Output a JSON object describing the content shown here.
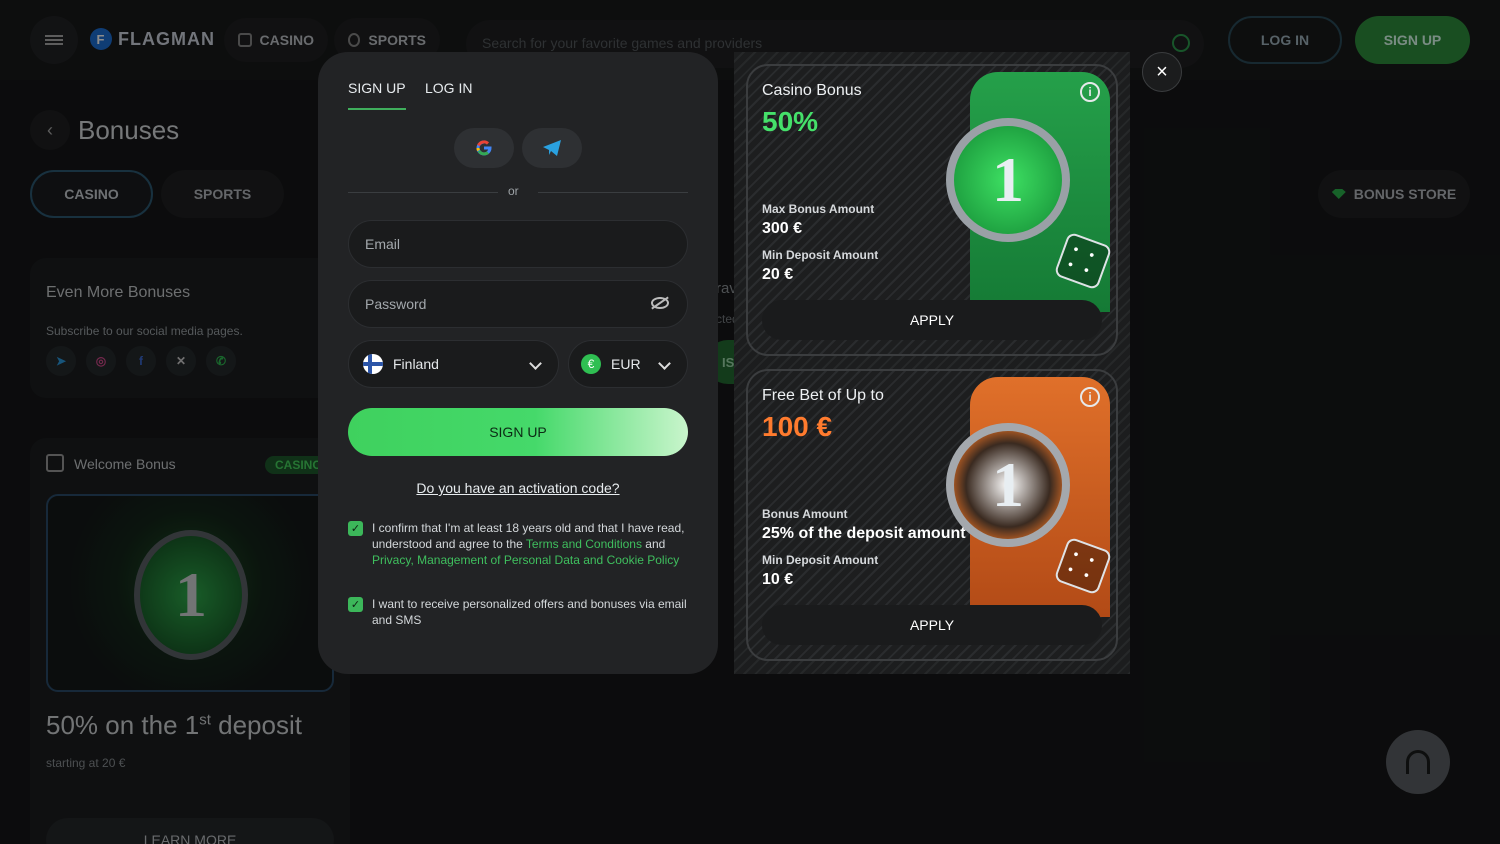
{
  "header": {
    "logo_letter": "F",
    "logo_text": "FLAGMAN",
    "nav_casino": "CASINO",
    "nav_sports": "SPORTS",
    "search_placeholder": "Search for your favorite games and providers",
    "login": "LOG IN",
    "signup": "SIGN UP"
  },
  "page": {
    "title": "Bonuses",
    "tab_casino": "CASINO",
    "tab_sports": "SPORTS",
    "bonus_store": "BONUS STORE",
    "more_title": "Even More Bonuses",
    "more_sub": "Subscribe to our social media pages.",
    "behind_title": "rave more?",
    "behind_sub": "cted poi",
    "behind_btn": "ISIT STORE",
    "welcome": {
      "title": "Welcome Bonus",
      "badge": "CASINO",
      "coin_number": "1",
      "pct_pre": "50% on the 1",
      "pct_sup": "st",
      "pct_post": " deposit",
      "starting": "starting at 20 €",
      "learn_more": "LEARN MORE"
    }
  },
  "modal": {
    "tab_signup": "SIGN UP",
    "tab_login": "LOG IN",
    "or": "or",
    "email_placeholder": "Email",
    "password_placeholder": "Password",
    "country": "Finland",
    "currency": "EUR",
    "currency_symbol": "€",
    "submit": "SIGN UP",
    "activation": "Do you have an activation code?",
    "consent1_pre": "I confirm that I'm at least 18 years old and that I have read, understood and agree to the ",
    "consent1_link1": "Terms and Conditions",
    "consent1_mid": " and ",
    "consent1_link2": "Privacy, Management of Personal Data and Cookie Policy",
    "consent2": "I want to receive personalized offers and bonuses via email and SMS",
    "consent1_checked": true,
    "consent2_checked": true
  },
  "bonuses": [
    {
      "title": "Casino Bonus",
      "value": "50%",
      "label1": "Max Bonus Amount",
      "value1": "300 €",
      "label2": "Min Deposit Amount",
      "value2": "20 €",
      "apply": "APPLY",
      "coin_number": "1",
      "accent": "#45e06a"
    },
    {
      "title": "Free Bet of Up to",
      "value": "100 €",
      "label1": "Bonus Amount",
      "value1": "25% of the deposit amount",
      "label2": "Min Deposit Amount",
      "value2": "10 €",
      "apply": "APPLY",
      "coin_number": "1",
      "accent": "#ff7b2e"
    }
  ],
  "icons": {
    "close": "×",
    "back": "‹",
    "info": "i",
    "check": "✓"
  }
}
